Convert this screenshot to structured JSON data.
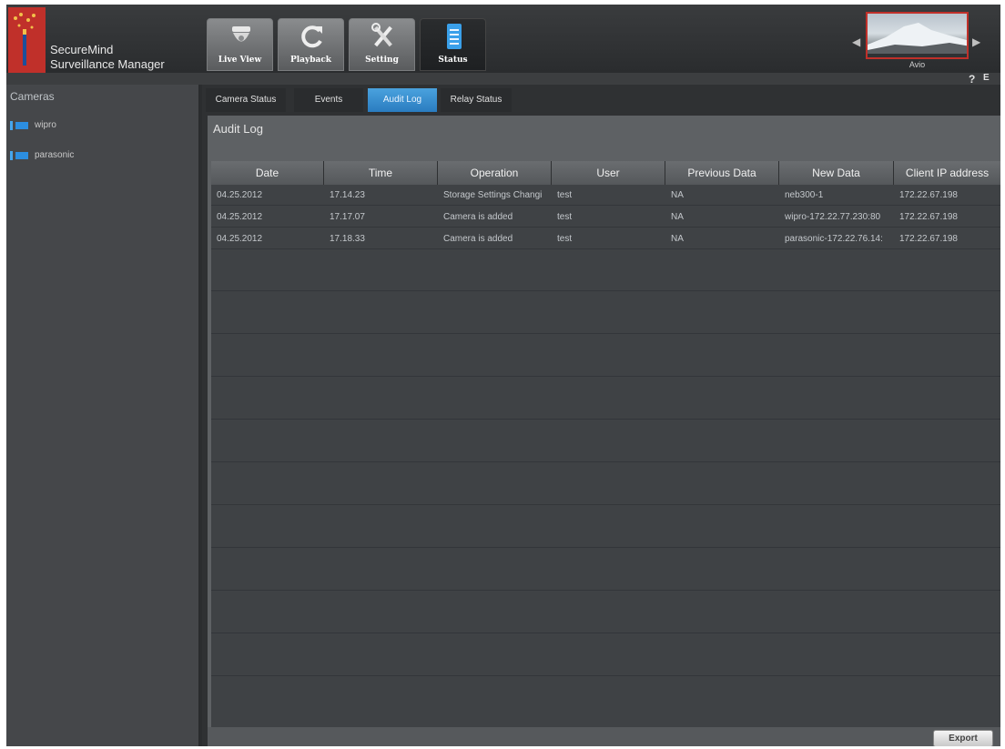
{
  "app": {
    "name_line1": "SecureMind",
    "name_line2": "Surveillance Manager"
  },
  "nav_tabs": [
    {
      "label": "Live View",
      "icon": "camera-dome-icon"
    },
    {
      "label": "Playback",
      "icon": "refresh-icon"
    },
    {
      "label": "Setting",
      "icon": "tools-icon"
    },
    {
      "label": "Status",
      "icon": "document-icon"
    }
  ],
  "active_nav_tab": "Status",
  "camera_preview": {
    "label": "Avio"
  },
  "header_icons": {
    "help": "?",
    "exit": "E"
  },
  "sidebar": {
    "title": "Cameras",
    "cameras": [
      {
        "label": "wipro",
        "icon": "camera-icon"
      },
      {
        "label": "parasonic",
        "icon": "camera-icon"
      }
    ]
  },
  "sub_tabs": [
    {
      "label": "Camera Status"
    },
    {
      "label": "Events"
    },
    {
      "label": "Audit Log"
    },
    {
      "label": "Relay Status"
    }
  ],
  "active_sub_tab": "Audit Log",
  "panel": {
    "title": "Audit Log"
  },
  "table": {
    "columns": [
      "Date",
      "Time",
      "Operation",
      "User",
      "Previous Data",
      "New Data",
      "Client IP address"
    ],
    "rows": [
      [
        "04.25.2012",
        "17.14.23",
        "Storage Settings Changi",
        "test",
        "NA",
        "neb300-1",
        "172.22.67.198"
      ],
      [
        "04.25.2012",
        "17.17.07",
        "Camera is added",
        "test",
        "NA",
        "wipro-172.22.77.230:80",
        "172.22.67.198"
      ],
      [
        "04.25.2012",
        "17.18.33",
        "Camera is added",
        "test",
        "NA",
        "parasonic-172.22.76.14:",
        "172.22.67.198"
      ]
    ]
  },
  "footer": {
    "export_label": "Export"
  },
  "colors": {
    "brand_red": "#c0302a",
    "active_tab_blue": "#3a90d0",
    "background": "#2b2d2f"
  }
}
